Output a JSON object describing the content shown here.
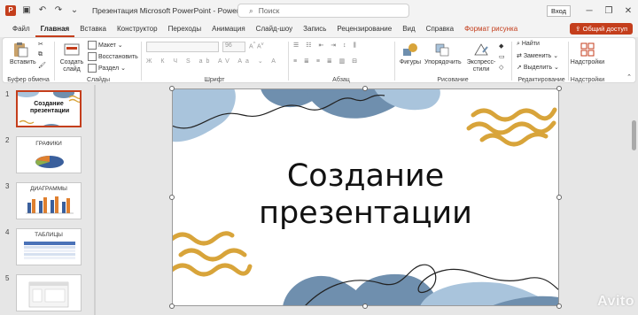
{
  "app": {
    "title": "Презентация Microsoft PowerPoint  -  PowerPoint",
    "search_placeholder": "Поиск",
    "signin_label": "Вход",
    "share_label": "Общий доступ"
  },
  "tabs": [
    {
      "label": "Файл"
    },
    {
      "label": "Главная"
    },
    {
      "label": "Вставка"
    },
    {
      "label": "Конструктор"
    },
    {
      "label": "Переходы"
    },
    {
      "label": "Анимация"
    },
    {
      "label": "Слайд-шоу"
    },
    {
      "label": "Запись"
    },
    {
      "label": "Рецензирование"
    },
    {
      "label": "Вид"
    },
    {
      "label": "Справка"
    },
    {
      "label": "Формат рисунка"
    }
  ],
  "ribbon": {
    "clipboard": {
      "paste": "Вставить",
      "label": "Буфер обмена"
    },
    "slides": {
      "new_slide": "Создать слайд",
      "layout": "Макет",
      "reset": "Восстановить",
      "section": "Раздел",
      "label": "Слайды"
    },
    "font": {
      "font_name": "",
      "font_size": "96",
      "label": "Шрифт"
    },
    "paragraph": {
      "label": "Абзац"
    },
    "drawing": {
      "shapes": "Фигуры",
      "arrange": "Упорядочить",
      "quick_styles": "Экспресс-стили",
      "label": "Рисование"
    },
    "editing": {
      "find": "Найти",
      "replace": "Заменить",
      "select": "Выделить",
      "label": "Редактирование"
    },
    "addins": {
      "addins": "Надстройки",
      "label": "Надстройки"
    }
  },
  "thumbnails": [
    {
      "num": "1",
      "text": "Создание презентации"
    },
    {
      "num": "2",
      "text": "ГРАФИКИ"
    },
    {
      "num": "3",
      "text": "ДИАГРАММЫ"
    },
    {
      "num": "4",
      "text": "ТАБЛИЦЫ"
    },
    {
      "num": "5",
      "text": ""
    }
  ],
  "slide": {
    "title": "Создание\nпрезентации"
  },
  "watermark": "Avito",
  "colors": {
    "accent": "#c43e1c",
    "wave_blue_dark": "#6f8fae",
    "wave_blue_light": "#a9c4dc",
    "wave_gold": "#d8a43a"
  }
}
